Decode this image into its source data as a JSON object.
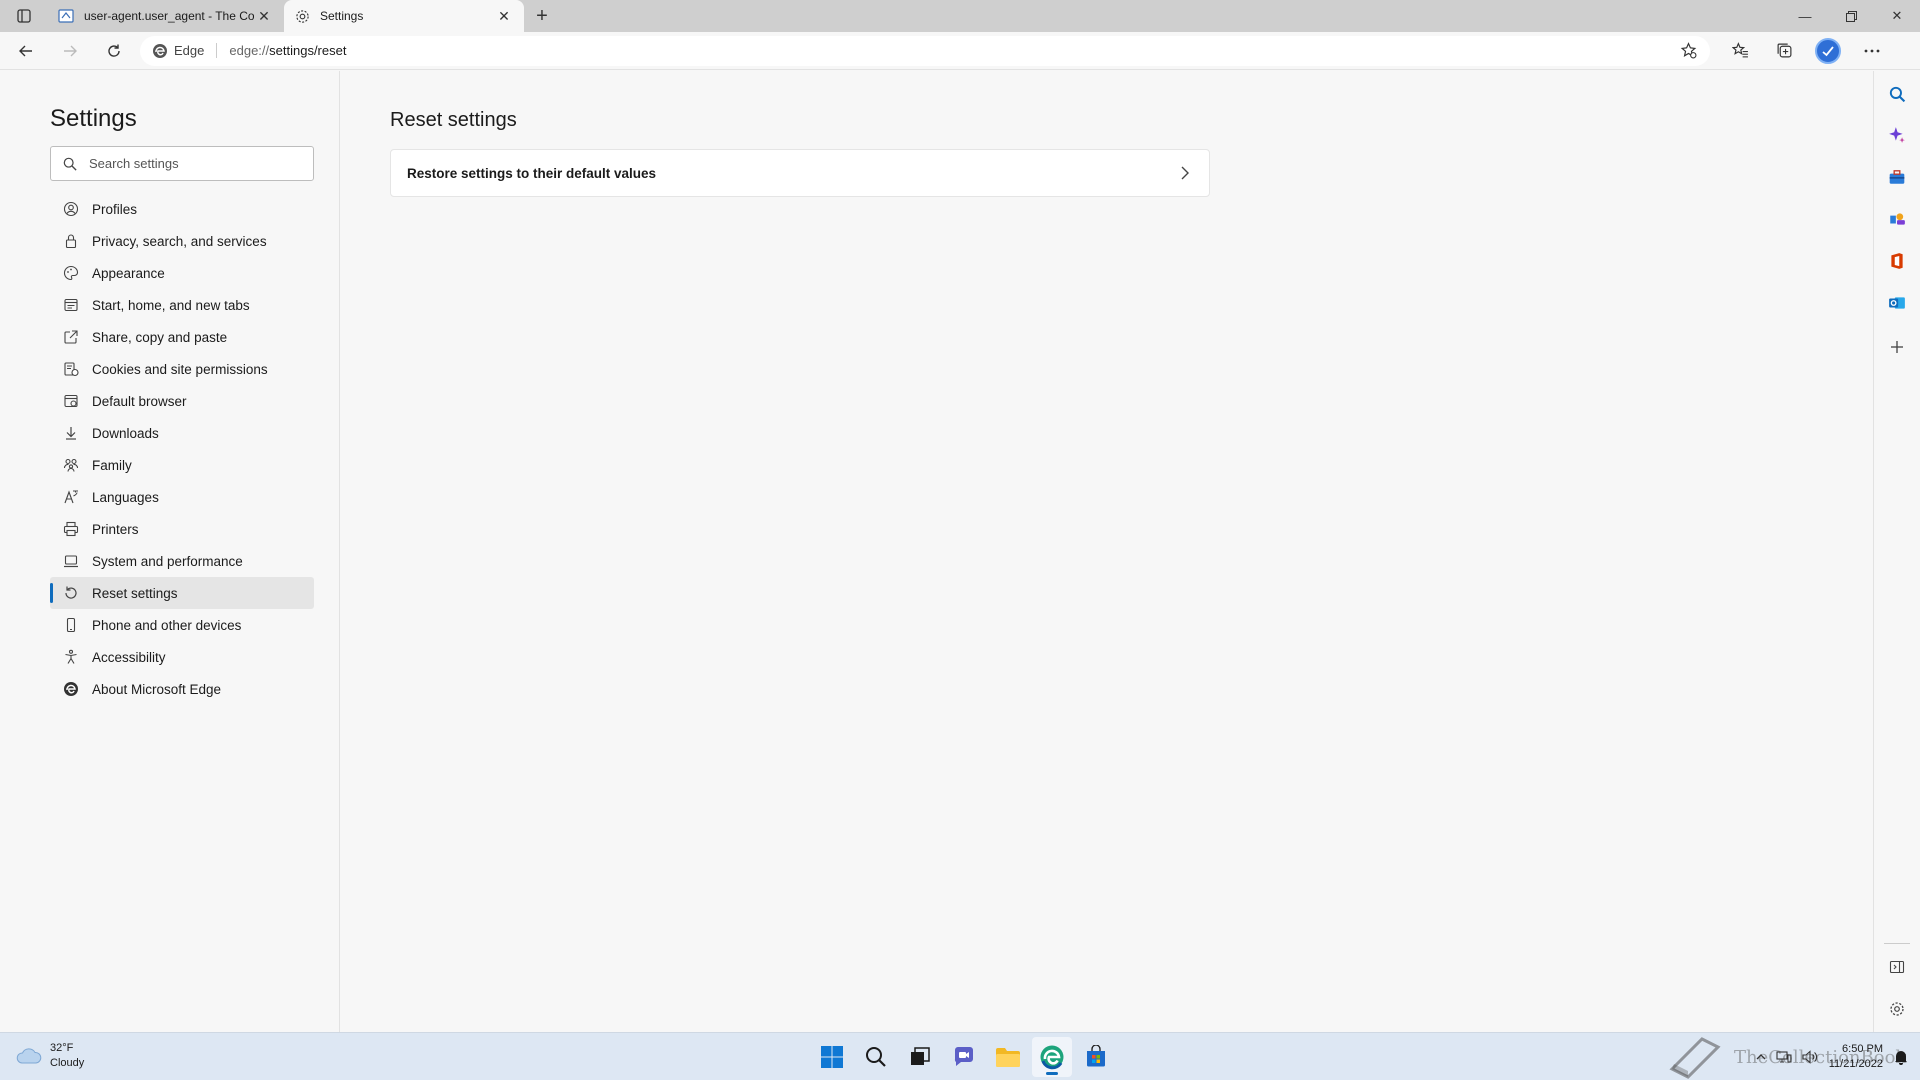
{
  "browser": {
    "tabs": [
      {
        "title": "user-agent.user_agent - The Coll",
        "active": false
      },
      {
        "title": "Settings",
        "active": true
      }
    ],
    "new_tab_symbol": "+",
    "site_label": "Edge",
    "url_scheme": "edge://",
    "url_path": "settings/reset"
  },
  "settings": {
    "title": "Settings",
    "search_placeholder": "Search settings",
    "nav_items": [
      {
        "label": "Profiles",
        "icon": "profile-icon"
      },
      {
        "label": "Privacy, search, and services",
        "icon": "lock-icon"
      },
      {
        "label": "Appearance",
        "icon": "palette-icon"
      },
      {
        "label": "Start, home, and new tabs",
        "icon": "home-tabs-icon"
      },
      {
        "label": "Share, copy and paste",
        "icon": "share-icon"
      },
      {
        "label": "Cookies and site permissions",
        "icon": "cookies-icon"
      },
      {
        "label": "Default browser",
        "icon": "default-browser-icon"
      },
      {
        "label": "Downloads",
        "icon": "download-icon"
      },
      {
        "label": "Family",
        "icon": "family-icon"
      },
      {
        "label": "Languages",
        "icon": "languages-icon"
      },
      {
        "label": "Printers",
        "icon": "printer-icon"
      },
      {
        "label": "System and performance",
        "icon": "laptop-icon"
      },
      {
        "label": "Reset settings",
        "icon": "reset-icon",
        "selected": true
      },
      {
        "label": "Phone and other devices",
        "icon": "phone-icon"
      },
      {
        "label": "Accessibility",
        "icon": "accessibility-icon"
      },
      {
        "label": "About Microsoft Edge",
        "icon": "edge-logo-icon"
      }
    ]
  },
  "main": {
    "page_title": "Reset settings",
    "card_label": "Restore settings to their default values"
  },
  "taskbar": {
    "weather_temp": "32°F",
    "weather_desc": "Cloudy",
    "time": "6:50 PM",
    "date": "11/21/2022",
    "watermark": "TheCollectionBook"
  },
  "colors": {
    "accent": "#0f6cbd",
    "taskbar_bg": "#dde7f3"
  }
}
